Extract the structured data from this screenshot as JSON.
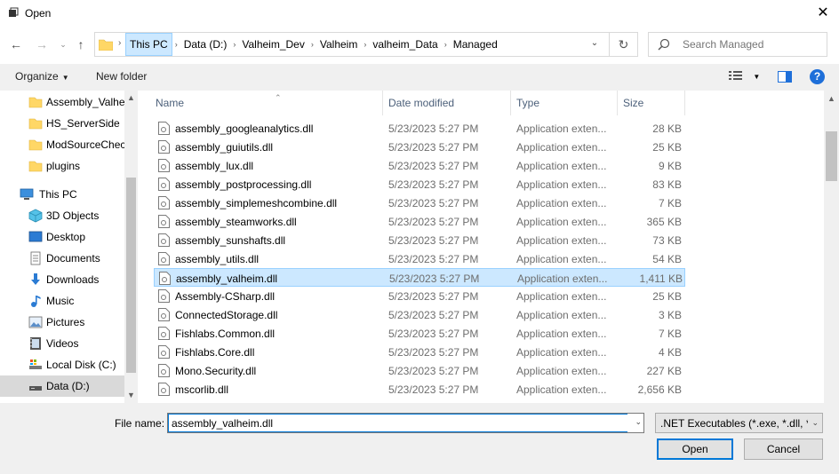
{
  "window": {
    "title": "Open"
  },
  "address": {
    "crumbs": [
      "This PC",
      "Data (D:)",
      "Valheim_Dev",
      "Valheim",
      "valheim_Data",
      "Managed"
    ]
  },
  "search": {
    "placeholder": "Search Managed"
  },
  "toolbar": {
    "organize": "Organize",
    "new_folder": "New folder"
  },
  "sidebar": {
    "items": [
      {
        "label": "Assembly_Valheim",
        "icon": "folder-icon"
      },
      {
        "label": "HS_ServerSide",
        "icon": "folder-icon"
      },
      {
        "label": "ModSourceChecker",
        "icon": "folder-icon"
      },
      {
        "label": "plugins",
        "icon": "folder-icon"
      },
      {
        "label": "This PC",
        "icon": "computer-icon"
      },
      {
        "label": "3D Objects",
        "icon": "cube-icon"
      },
      {
        "label": "Desktop",
        "icon": "desktop-icon"
      },
      {
        "label": "Documents",
        "icon": "documents-icon"
      },
      {
        "label": "Downloads",
        "icon": "download-icon"
      },
      {
        "label": "Music",
        "icon": "music-icon"
      },
      {
        "label": "Pictures",
        "icon": "pictures-icon"
      },
      {
        "label": "Videos",
        "icon": "videos-icon"
      },
      {
        "label": "Local Disk (C:)",
        "icon": "drive-icon"
      },
      {
        "label": "Data (D:)",
        "icon": "drive-icon"
      }
    ]
  },
  "columns": {
    "name": "Name",
    "date": "Date modified",
    "type": "Type",
    "size": "Size"
  },
  "files": [
    {
      "name": "assembly_googleanalytics.dll",
      "date": "5/23/2023 5:27 PM",
      "type": "Application exten...",
      "size": "28 KB"
    },
    {
      "name": "assembly_guiutils.dll",
      "date": "5/23/2023 5:27 PM",
      "type": "Application exten...",
      "size": "25 KB"
    },
    {
      "name": "assembly_lux.dll",
      "date": "5/23/2023 5:27 PM",
      "type": "Application exten...",
      "size": "9 KB"
    },
    {
      "name": "assembly_postprocessing.dll",
      "date": "5/23/2023 5:27 PM",
      "type": "Application exten...",
      "size": "83 KB"
    },
    {
      "name": "assembly_simplemeshcombine.dll",
      "date": "5/23/2023 5:27 PM",
      "type": "Application exten...",
      "size": "7 KB"
    },
    {
      "name": "assembly_steamworks.dll",
      "date": "5/23/2023 5:27 PM",
      "type": "Application exten...",
      "size": "365 KB"
    },
    {
      "name": "assembly_sunshafts.dll",
      "date": "5/23/2023 5:27 PM",
      "type": "Application exten...",
      "size": "73 KB"
    },
    {
      "name": "assembly_utils.dll",
      "date": "5/23/2023 5:27 PM",
      "type": "Application exten...",
      "size": "54 KB"
    },
    {
      "name": "assembly_valheim.dll",
      "date": "5/23/2023 5:27 PM",
      "type": "Application exten...",
      "size": "1,411 KB"
    },
    {
      "name": "Assembly-CSharp.dll",
      "date": "5/23/2023 5:27 PM",
      "type": "Application exten...",
      "size": "25 KB"
    },
    {
      "name": "ConnectedStorage.dll",
      "date": "5/23/2023 5:27 PM",
      "type": "Application exten...",
      "size": "3 KB"
    },
    {
      "name": "Fishlabs.Common.dll",
      "date": "5/23/2023 5:27 PM",
      "type": "Application exten...",
      "size": "7 KB"
    },
    {
      "name": "Fishlabs.Core.dll",
      "date": "5/23/2023 5:27 PM",
      "type": "Application exten...",
      "size": "4 KB"
    },
    {
      "name": "Mono.Security.dll",
      "date": "5/23/2023 5:27 PM",
      "type": "Application exten...",
      "size": "227 KB"
    },
    {
      "name": "mscorlib.dll",
      "date": "5/23/2023 5:27 PM",
      "type": "Application exten...",
      "size": "2,656 KB"
    }
  ],
  "footer": {
    "file_name_label": "File name:",
    "file_name_value": "assembly_valheim.dll",
    "file_type": ".NET Executables (*.exe, *.dll, *.",
    "open": "Open",
    "cancel": "Cancel"
  },
  "colors": {
    "selection": "#cce8ff",
    "accent": "#0078d7",
    "folder": "#ffd766"
  }
}
